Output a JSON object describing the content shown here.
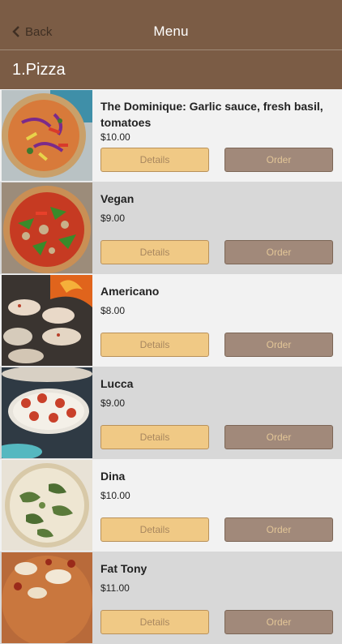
{
  "navbar": {
    "back_label": "Back",
    "title": "Menu",
    "back_icon": "chevron-left-icon"
  },
  "section": {
    "title": "1.Pizza"
  },
  "items": [
    {
      "name": "The Dominique: Garlic sauce, fresh basil, tomatoes",
      "price": "$10.00",
      "details_label": "Details",
      "order_label": "Order"
    },
    {
      "name": "Vegan",
      "price": "$9.00",
      "details_label": "Details",
      "order_label": "Order"
    },
    {
      "name": "Americano",
      "price": "$8.00",
      "details_label": "Details",
      "order_label": "Order"
    },
    {
      "name": "Lucca",
      "price": "$9.00",
      "details_label": "Details",
      "order_label": "Order"
    },
    {
      "name": "Dina",
      "price": "$10.00",
      "details_label": "Details",
      "order_label": "Order"
    },
    {
      "name": "Fat Tony",
      "price": "$11.00",
      "details_label": "Details",
      "order_label": "Order"
    }
  ],
  "colors": {
    "header_brown": "#7b5c45",
    "details_button": "#f0c985",
    "order_button": "#a1897a",
    "row_light": "#f2f2f2",
    "row_dark": "#d8d8d8"
  }
}
